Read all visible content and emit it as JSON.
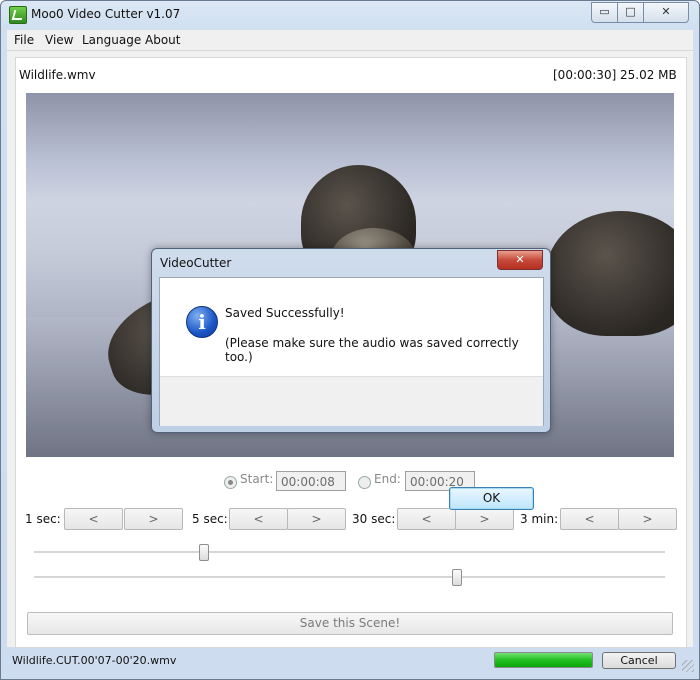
{
  "window": {
    "title": "Moo0 Video Cutter v1.07",
    "app_icon": "app-icon",
    "caption": {
      "minimize": "▭",
      "maximize": "□",
      "close": "✕"
    }
  },
  "menu": {
    "items": [
      "File",
      "View",
      "Language",
      "About"
    ]
  },
  "file": {
    "name": "Wildlife.wmv",
    "duration": "[00:00:30]",
    "size": "25.02 MB"
  },
  "times": {
    "start_label": "Start:",
    "start_value": "00:00:08",
    "start_checked": true,
    "end_label": "End:",
    "end_value": "00:00:20",
    "end_checked": false
  },
  "steps": [
    {
      "label": "1 sec:",
      "back": "<",
      "fwd": ">"
    },
    {
      "label": "5 sec:",
      "back": "<",
      "fwd": ">"
    },
    {
      "label": "30 sec:",
      "back": "<",
      "fwd": ">"
    },
    {
      "label": "3 min:",
      "back": "<",
      "fwd": ">"
    }
  ],
  "sliders": {
    "start_fraction": 0.27,
    "end_fraction": 0.67
  },
  "save_scene_label": "Save this Scene!",
  "status": {
    "output_file": "Wildlife.CUT.00'07-00'20.wmv",
    "progress": 1.0,
    "cancel_label": "Cancel"
  },
  "dialog": {
    "title": "VideoCutter",
    "close": "✕",
    "icon": "info-icon",
    "line1": "Saved Successfully!",
    "line2": "(Please make sure the audio was saved correctly too.)",
    "ok_label": "OK"
  },
  "colors": {
    "progress": "#22c022",
    "dialog_close": "#c64a3a",
    "info_icon": "#1a55c6"
  }
}
